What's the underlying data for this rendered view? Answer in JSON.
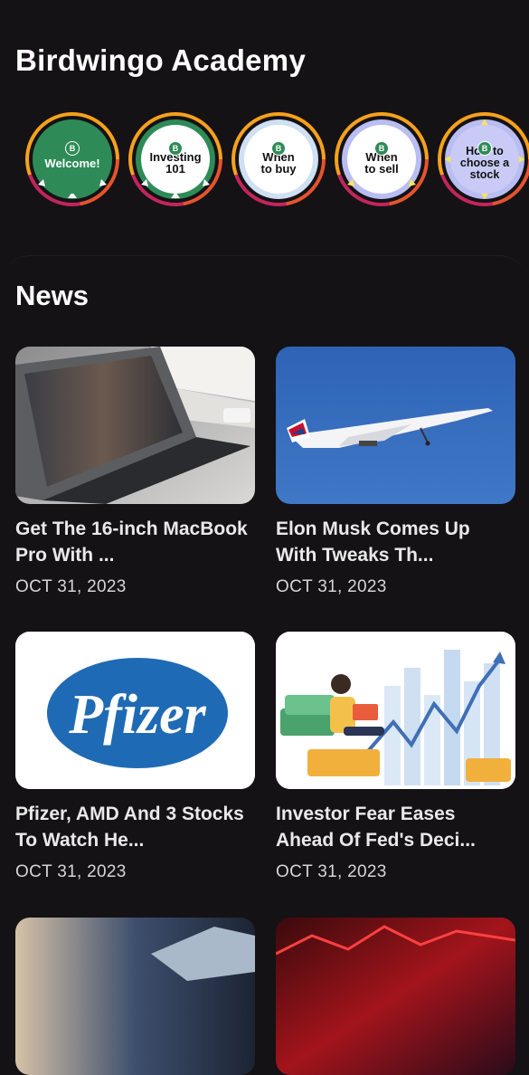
{
  "academy": {
    "title": "Birdwingo Academy",
    "logo_letter": "B",
    "badges": [
      {
        "label": "Welcome!",
        "disc": "#2e8b57",
        "inner": "#2e8b57",
        "text": "#ffffff"
      },
      {
        "label": "Investing 101",
        "disc": "#2e8b57",
        "inner": "#ffffff",
        "text": "#111111"
      },
      {
        "label": "When to buy",
        "disc": "#cfe0f5",
        "inner": "#ffffff",
        "text": "#111111"
      },
      {
        "label": "When to sell",
        "disc": "#b9bdf2",
        "inner": "#ffffff",
        "text": "#111111"
      },
      {
        "label": "How to choose a stock",
        "disc": "#b9bdf2",
        "inner": "#c9cbf6",
        "text": "#111111"
      }
    ]
  },
  "news": {
    "title": "News",
    "articles": [
      {
        "title": "Get The 16-inch MacBook Pro With ...",
        "date": "OCT 31, 2023",
        "image": "laptop"
      },
      {
        "title": "Elon Musk Comes Up With Tweaks Th...",
        "date": "OCT 31, 2023",
        "image": "jet"
      },
      {
        "title": "Pfizer, AMD And 3 Stocks To Watch He...",
        "date": "OCT 31, 2023",
        "image": "pfizer-logo",
        "logo_text": "Pfizer"
      },
      {
        "title": "Investor Fear Eases Ahead Of Fed's Deci...",
        "date": "OCT 31, 2023",
        "image": "investor-chart"
      },
      {
        "title": "",
        "date": "",
        "image": "keyboard"
      },
      {
        "title": "",
        "date": "",
        "image": "red-chart"
      }
    ]
  }
}
